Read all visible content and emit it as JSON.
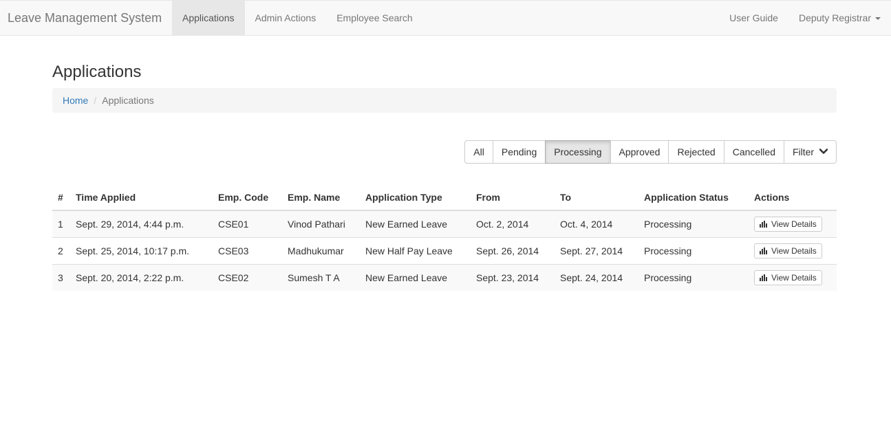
{
  "navbar": {
    "brand": "Leave Management System",
    "items": [
      {
        "label": "Applications",
        "active": true
      },
      {
        "label": "Admin Actions",
        "active": false
      },
      {
        "label": "Employee Search",
        "active": false
      }
    ],
    "user_guide": "User Guide",
    "user_menu": "Deputy Registrar"
  },
  "page": {
    "title": "Applications"
  },
  "breadcrumb": {
    "home": "Home",
    "current": "Applications",
    "separator": "/"
  },
  "filters": {
    "all": "All",
    "pending": "Pending",
    "processing": "Processing",
    "approved": "Approved",
    "rejected": "Rejected",
    "cancelled": "Cancelled",
    "filter": "Filter",
    "active": "Processing"
  },
  "table": {
    "headers": [
      "#",
      "Time Applied",
      "Emp. Code",
      "Emp. Name",
      "Application Type",
      "From",
      "To",
      "Application Status",
      "Actions"
    ],
    "rows": [
      [
        "1",
        "Sept. 29, 2014, 4:44 p.m.",
        "CSE01",
        "Vinod Pathari",
        "New Earned Leave",
        "Oct. 2, 2014",
        "Oct. 4, 2014",
        "Processing",
        "View Details"
      ],
      [
        "2",
        "Sept. 25, 2014, 10:17 p.m.",
        "CSE03",
        "Madhukumar",
        "New Half Pay Leave",
        "Sept. 26, 2014",
        "Sept. 27, 2014",
        "Processing",
        "View Details"
      ],
      [
        "3",
        "Sept. 20, 2014, 2:22 p.m.",
        "CSE02",
        "Sumesh T A",
        "New Earned Leave",
        "Sept. 23, 2014",
        "Sept. 24, 2014",
        "Processing",
        "View Details"
      ]
    ]
  },
  "icons": {
    "view_details": "bar-chart-icon",
    "filter": "chevron-down-icon",
    "user_menu": "caret-down-icon"
  },
  "colors": {
    "link": "#337ab7",
    "navbar_bg": "#f8f8f8",
    "nav_active_bg": "#e7e7e7"
  }
}
